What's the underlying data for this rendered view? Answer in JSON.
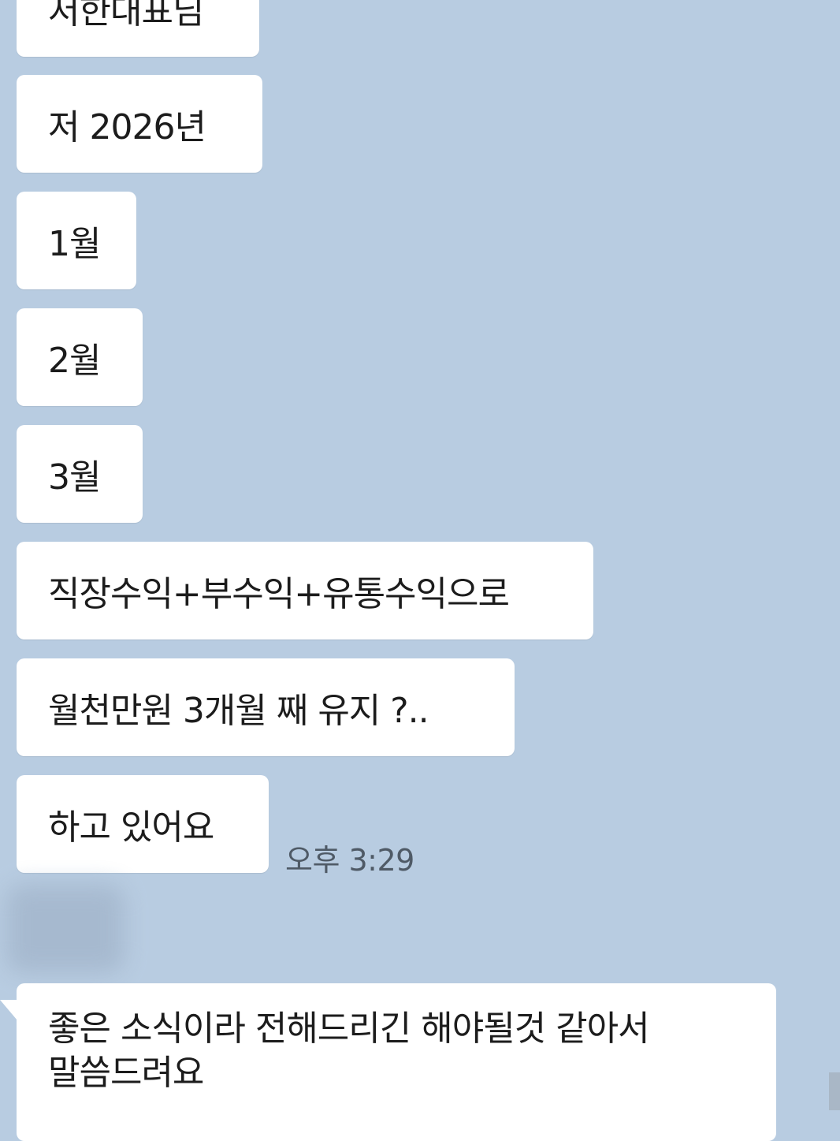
{
  "chat": {
    "messages": [
      {
        "text": "저한대표님"
      },
      {
        "text": "저 2026년"
      },
      {
        "text": "1월"
      },
      {
        "text": "2월"
      },
      {
        "text": "3월"
      },
      {
        "text": "직장수익+부수익+유통수익으로"
      },
      {
        "text": "월천만원 3개월 째 유지 ?.."
      },
      {
        "text": "하고 있어요"
      }
    ],
    "timestamp": "오후 3:29",
    "reply": {
      "line1": "좋은 소식이라 전해드리긴 해야될것 같아서",
      "line2": "말씀드려요"
    }
  },
  "colors": {
    "background": "#b8cce1",
    "bubble": "#ffffff",
    "timestamp": "#4f5a66"
  }
}
